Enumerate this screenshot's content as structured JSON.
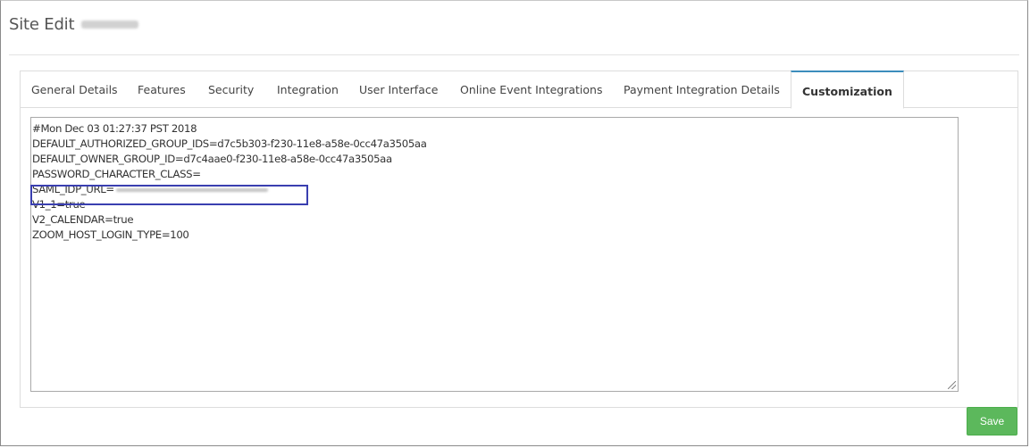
{
  "header": {
    "title": "Site Edit"
  },
  "tabs": [
    {
      "label": "General Details"
    },
    {
      "label": "Features"
    },
    {
      "label": "Security"
    },
    {
      "label": "Integration"
    },
    {
      "label": "User Interface"
    },
    {
      "label": "Online Event Integrations"
    },
    {
      "label": "Payment Integration Details"
    },
    {
      "label": "Customization",
      "active": true
    }
  ],
  "editor": {
    "lines": [
      "#Mon Dec 03 01:27:37 PST 2018",
      "DEFAULT_AUTHORIZED_GROUP_IDS=d7c5b303-f230-11e8-a58e-0cc47a3505aa",
      "DEFAULT_OWNER_GROUP_ID=d7c4aae0-f230-11e8-a58e-0cc47a3505aa",
      "PASSWORD_CHARACTER_CLASS=",
      "SAML_IDP_URL=",
      "V1_1=true",
      "V2_CALENDAR=true",
      "ZOOM_HOST_LOGIN_TYPE=100"
    ]
  },
  "actions": {
    "save_label": "Save"
  },
  "colors": {
    "tab_active_border": "#3c8dbc",
    "highlight_box": "#3a3fb0",
    "save_button": "#5cb85c"
  }
}
